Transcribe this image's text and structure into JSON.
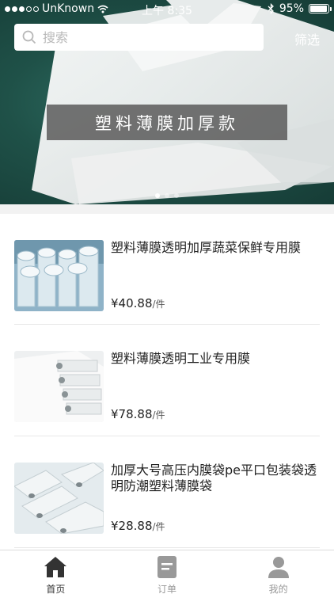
{
  "status_bar": {
    "carrier": "UnKnown",
    "time": "上午 8:35",
    "battery": "95%",
    "battery_level": 0.95
  },
  "search": {
    "placeholder": "搜索"
  },
  "filter_label": "筛选",
  "banner": {
    "caption": "塑料薄膜加厚款",
    "page_count": 3,
    "active_page": 1
  },
  "products": [
    {
      "title": "塑料薄膜透明加厚蔬菜保鲜专用膜",
      "price": "¥40.88",
      "unit": "/件"
    },
    {
      "title": "塑料薄膜透明工业专用膜",
      "price": "¥78.88",
      "unit": "/件"
    },
    {
      "title": "加厚大号高压内膜袋pe平口包装袋透明防潮塑料薄膜袋",
      "price": "¥28.88",
      "unit": "/件"
    }
  ],
  "tabs": [
    {
      "label": "首页",
      "icon": "home-icon",
      "active": true
    },
    {
      "label": "订单",
      "icon": "order-icon",
      "active": false
    },
    {
      "label": "我的",
      "icon": "profile-icon",
      "active": false
    }
  ],
  "colors": {
    "banner_green": "#1f5148",
    "tab_active": "#333333",
    "tab_inactive": "#999999"
  }
}
